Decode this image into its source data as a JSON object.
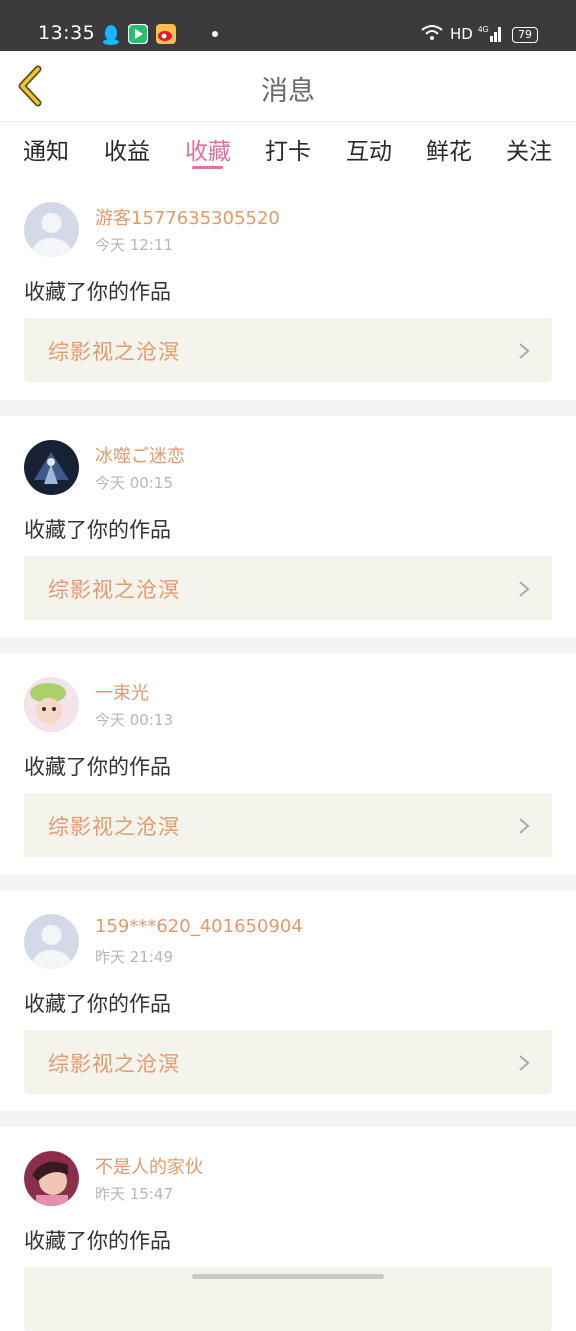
{
  "status_bar": {
    "time": "13:35",
    "network": "HD",
    "signal_type": "4G",
    "battery": "79"
  },
  "header": {
    "title": "消息"
  },
  "tabs": [
    {
      "label": "通知"
    },
    {
      "label": "收益"
    },
    {
      "label": "收藏",
      "active": true
    },
    {
      "label": "打卡"
    },
    {
      "label": "互动"
    },
    {
      "label": "鲜花"
    },
    {
      "label": "关注"
    }
  ],
  "notifications": [
    {
      "username": "游客1577635305520",
      "time": "今天 12:11",
      "action": "收藏了你的作品",
      "work": "综影视之沧溟",
      "avatar": "default-avatar"
    },
    {
      "username": "冰噬ご迷恋",
      "time": "今天 00:15",
      "action": "收藏了你的作品",
      "work": "综影视之沧溟",
      "avatar": "dark-character-avatar"
    },
    {
      "username": "一束光",
      "time": "今天 00:13",
      "action": "收藏了你的作品",
      "work": "综影视之沧溟",
      "avatar": "girl-green-hat-avatar"
    },
    {
      "username": "159***620_401650904",
      "time": "昨天 21:49",
      "action": "收藏了你的作品",
      "work": "综影视之沧溟",
      "avatar": "default-avatar"
    },
    {
      "username": "不是人的家伙",
      "time": "昨天 15:47",
      "action": "收藏了你的作品",
      "work": "",
      "avatar": "girl-photo-avatar"
    }
  ],
  "colors": {
    "accent": "#e0739d",
    "username": "#e69a6b",
    "work_bg": "#f4f3ec",
    "status_bar": "#3b3b3d"
  }
}
